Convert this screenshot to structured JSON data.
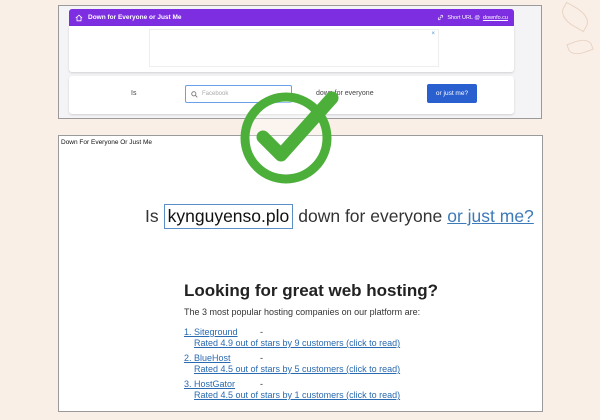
{
  "top": {
    "app_title": "Down for Everyone or Just Me",
    "short_url_label": "Short URL @",
    "short_url_link": "downfo.cu",
    "ad_close": "×",
    "query_prefix": "Is",
    "query_placeholder": "Facebook",
    "query_suffix": "down for everyone",
    "button_label": "or just me?"
  },
  "bottom": {
    "page_title": "Down For Everyone Or Just Me",
    "prefix": "Is",
    "domain_value": "kynguyenso.plo",
    "suffix": "down for everyone",
    "link": "or just me?",
    "hosting_heading": "Looking for great web hosting?",
    "hosting_sub": "The 3 most popular hosting companies on our platform are:",
    "hosts": [
      {
        "name": "1. Siteground",
        "dash": "-",
        "rating": "Rated 4.9 out of stars by 9 customers (click to read)"
      },
      {
        "name": "2. BlueHost",
        "dash": "-",
        "rating": "Rated 4.5 out of stars by 5 customers (click to read)"
      },
      {
        "name": "3. HostGator",
        "dash": "-",
        "rating": "Rated 4.5 out of stars by 1 customers (click to read)"
      }
    ]
  },
  "colors": {
    "accent_purple": "#7c2ee0",
    "button_blue": "#2a5fd0",
    "check_green": "#4caf3a",
    "link_blue": "#3d7ab8"
  },
  "icons": [
    "home-icon",
    "link-icon",
    "search-icon",
    "checkmark-icon"
  ]
}
